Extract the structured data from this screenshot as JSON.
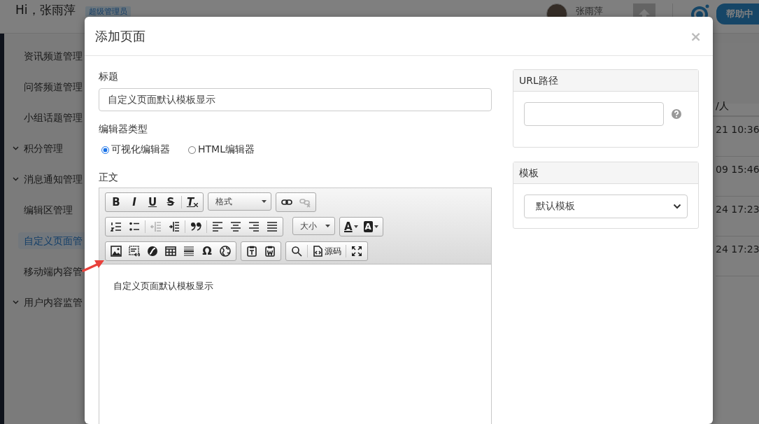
{
  "header": {
    "greeting": "Hi，张雨萍",
    "role_badge": "超级管理员",
    "user_name": "张雨萍",
    "help_button": "帮助中"
  },
  "sidebar": {
    "items": [
      {
        "label": "资讯频道管理",
        "kind": "item",
        "selected": false
      },
      {
        "label": "问答频道管理",
        "kind": "item",
        "selected": false
      },
      {
        "label": "小组话题管理",
        "kind": "item",
        "selected": false
      },
      {
        "label": "积分管理",
        "kind": "group",
        "selected": false
      },
      {
        "label": "消息通知管理",
        "kind": "group",
        "selected": false
      },
      {
        "label": "编辑区管理",
        "kind": "item",
        "selected": false
      },
      {
        "label": "自定义页面管",
        "kind": "item",
        "selected": true
      },
      {
        "label": "移动端内容管",
        "kind": "item",
        "selected": false
      },
      {
        "label": "用户内容监管",
        "kind": "group",
        "selected": false
      }
    ]
  },
  "table": {
    "column_header": "/人",
    "rows": [
      {
        "time": "21 10:36"
      },
      {
        "time": "09 15:46"
      },
      {
        "time": "24 17:23"
      },
      {
        "time": "24 17:23"
      }
    ]
  },
  "dialog": {
    "title": "添加页面",
    "close": "×",
    "title_field": {
      "label": "标题",
      "value": "自定义页面默认模板显示"
    },
    "editor_type": {
      "label": "编辑器类型",
      "options": [
        {
          "label": "可视化编辑器",
          "selected": true
        },
        {
          "label": "HTML编辑器",
          "selected": false
        }
      ]
    },
    "body": {
      "label": "正文",
      "content": "自定义页面默认模板显示",
      "toolbar": [
        [
          {
            "buttons": [
              {
                "kind": "bold",
                "glyph": "B",
                "disabled": false
              },
              {
                "kind": "italic",
                "glyph": "I",
                "disabled": false
              },
              {
                "kind": "underline",
                "glyph": "U",
                "disabled": false
              },
              {
                "kind": "strike",
                "glyph": "S",
                "disabled": false
              },
              {
                "kind": "separator"
              },
              {
                "kind": "clear",
                "glyph": "T",
                "disabled": false
              }
            ]
          },
          {
            "kind": "combo",
            "label": "格式"
          },
          {
            "buttons": [
              {
                "kind": "link",
                "disabled": false
              },
              {
                "kind": "unlink",
                "disabled": true
              }
            ]
          }
        ],
        [
          {
            "buttons": [
              {
                "kind": "ol",
                "disabled": false
              },
              {
                "kind": "ul",
                "disabled": false
              },
              {
                "kind": "separator"
              },
              {
                "kind": "outdent",
                "disabled": true
              },
              {
                "kind": "indent",
                "disabled": false
              },
              {
                "kind": "separator"
              },
              {
                "kind": "quote",
                "disabled": false
              },
              {
                "kind": "separator"
              },
              {
                "kind": "align-left",
                "disabled": false
              },
              {
                "kind": "align-center",
                "disabled": false
              },
              {
                "kind": "align-right",
                "disabled": false
              },
              {
                "kind": "justify",
                "disabled": false
              }
            ]
          },
          {
            "kind": "combo",
            "label": "大小"
          },
          {
            "buttons": [
              {
                "kind": "text-color",
                "glyph": "A",
                "disabled": false
              },
              {
                "kind": "bg-color",
                "glyph": "A",
                "disabled": false
              }
            ]
          }
        ],
        [
          {
            "buttons": [
              {
                "kind": "image",
                "disabled": false
              },
              {
                "kind": "iframe",
                "disabled": false
              },
              {
                "kind": "flash",
                "disabled": false
              },
              {
                "kind": "table",
                "disabled": false
              },
              {
                "kind": "hr",
                "disabled": false
              },
              {
                "kind": "special",
                "glyph": "Ω",
                "disabled": false
              },
              {
                "kind": "globe",
                "disabled": false
              }
            ]
          },
          {
            "buttons": [
              {
                "kind": "paste-text",
                "disabled": false
              },
              {
                "kind": "paste-word",
                "disabled": false
              }
            ]
          },
          {
            "buttons": [
              {
                "kind": "search",
                "disabled": false
              },
              {
                "kind": "separator"
              },
              {
                "kind": "source",
                "label": "源码",
                "disabled": false
              },
              {
                "kind": "separator"
              },
              {
                "kind": "maximize",
                "disabled": false
              }
            ]
          }
        ]
      ]
    },
    "url_panel": {
      "heading": "URL路径"
    },
    "template_panel": {
      "heading": "模板",
      "value": "默认模板"
    }
  }
}
